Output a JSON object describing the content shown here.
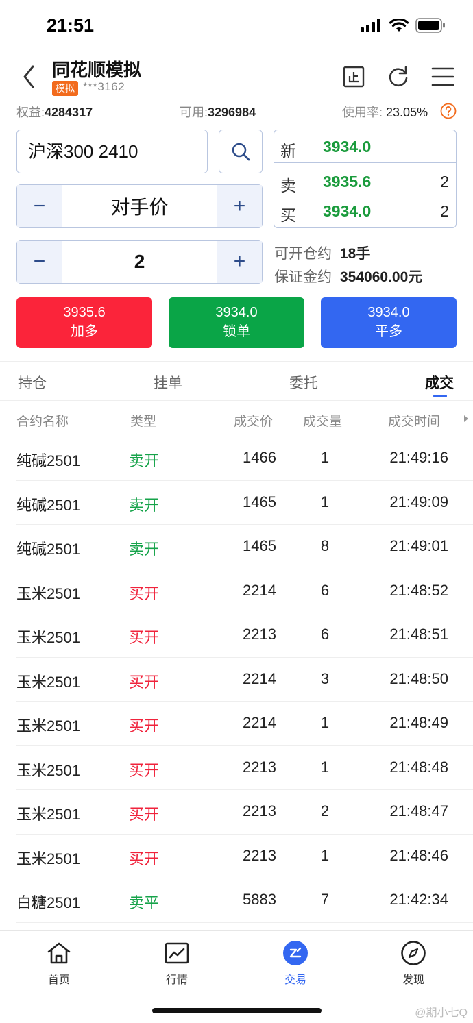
{
  "status_bar": {
    "time": "21:51"
  },
  "header": {
    "title": "同花顺模拟",
    "tag": "模拟",
    "account": "***3162"
  },
  "equity": {
    "equity_label": "权益:",
    "equity_value": "4284317",
    "available_label": "可用:",
    "available_value": "3296984",
    "usage_label": "使用率:",
    "usage_value": "23.05%"
  },
  "order": {
    "contract": "沪深300 2410",
    "price_type": "对手价",
    "quantity": "2",
    "minus": "−",
    "plus": "+"
  },
  "quote": {
    "new_label": "新",
    "new_price": "3934.0",
    "sell_label": "卖",
    "sell_price": "3935.6",
    "sell_qty": "2",
    "buy_label": "买",
    "buy_price": "3934.0",
    "buy_qty": "2"
  },
  "info": {
    "open_label": "可开仓约",
    "open_value": "18手",
    "margin_label": "保证金约",
    "margin_value": "354060.00元"
  },
  "actions": {
    "long": {
      "price": "3935.6",
      "label": "加多",
      "color": "#fb243a"
    },
    "lock": {
      "price": "3934.0",
      "label": "锁单",
      "color": "#0aa547"
    },
    "close_long": {
      "price": "3934.0",
      "label": "平多",
      "color": "#3367f1"
    }
  },
  "tabs": [
    "持仓",
    "挂单",
    "委托",
    "成交"
  ],
  "table": {
    "headers": [
      "合约名称",
      "类型",
      "成交价",
      "成交量",
      "成交时间"
    ],
    "rows": [
      {
        "name": "纯碱2501",
        "type": "卖开",
        "side": "sell",
        "price": "1466",
        "qty": "1",
        "time": "21:49:16"
      },
      {
        "name": "纯碱2501",
        "type": "卖开",
        "side": "sell",
        "price": "1465",
        "qty": "1",
        "time": "21:49:09"
      },
      {
        "name": "纯碱2501",
        "type": "卖开",
        "side": "sell",
        "price": "1465",
        "qty": "8",
        "time": "21:49:01"
      },
      {
        "name": "玉米2501",
        "type": "买开",
        "side": "buy",
        "price": "2214",
        "qty": "6",
        "time": "21:48:52"
      },
      {
        "name": "玉米2501",
        "type": "买开",
        "side": "buy",
        "price": "2213",
        "qty": "6",
        "time": "21:48:51"
      },
      {
        "name": "玉米2501",
        "type": "买开",
        "side": "buy",
        "price": "2214",
        "qty": "3",
        "time": "21:48:50"
      },
      {
        "name": "玉米2501",
        "type": "买开",
        "side": "buy",
        "price": "2214",
        "qty": "1",
        "time": "21:48:49"
      },
      {
        "name": "玉米2501",
        "type": "买开",
        "side": "buy",
        "price": "2213",
        "qty": "1",
        "time": "21:48:48"
      },
      {
        "name": "玉米2501",
        "type": "买开",
        "side": "buy",
        "price": "2213",
        "qty": "2",
        "time": "21:48:47"
      },
      {
        "name": "玉米2501",
        "type": "买开",
        "side": "buy",
        "price": "2213",
        "qty": "1",
        "time": "21:48:46"
      },
      {
        "name": "白糖2501",
        "type": "卖平",
        "side": "sell",
        "price": "5883",
        "qty": "7",
        "time": "21:42:34"
      }
    ],
    "colors": {
      "buy": "#f0233c",
      "sell": "#16a34a"
    }
  },
  "nav": [
    {
      "label": "首页",
      "icon": "home-icon"
    },
    {
      "label": "行情",
      "icon": "chart-icon"
    },
    {
      "label": "交易",
      "icon": "trade-icon"
    },
    {
      "label": "发现",
      "icon": "compass-icon"
    }
  ],
  "watermark": "@期小七Q"
}
